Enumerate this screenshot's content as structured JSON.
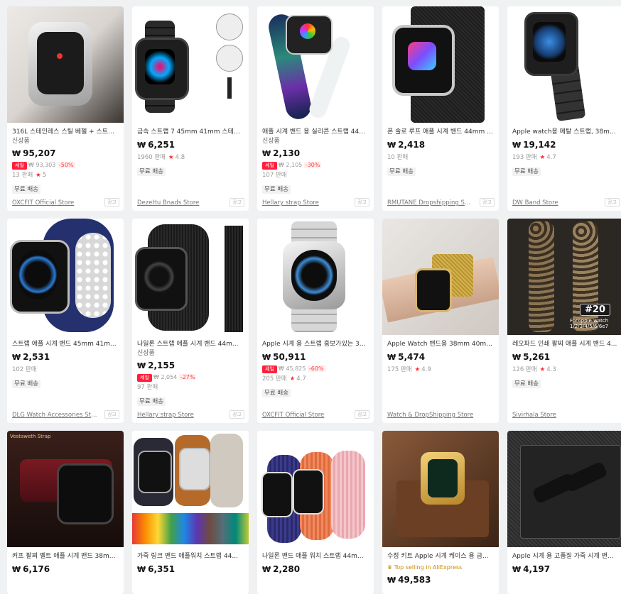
{
  "products": [
    {
      "title": "316L 스테인레스 스틸 베젤 + 스트랩...",
      "tag": "신상품",
      "price": "95,207",
      "sale_badge": "세일",
      "original": "93,303",
      "discount": "-50%",
      "sold": "13 판매",
      "rating": "5",
      "shipping": "무료 배송",
      "store": "OXCFIT Official Store",
      "ad": "광고"
    },
    {
      "title": "금속 스트랩 7 45mm 41mm 스테인...",
      "price": "6,251",
      "sold": "1960 판매",
      "rating": "4.8",
      "shipping": "무료 배송",
      "store": "DezeHu Bnads Store",
      "ad": "광고"
    },
    {
      "title": "애플 시계 밴드 용 실리콘 스트랩 44...",
      "tag": "신상품",
      "price": "2,130",
      "sale_badge": "세일",
      "original": "2,105",
      "discount": "-30%",
      "sold": "107 판매",
      "shipping": "무료 배송",
      "store": "Hellary strap Store",
      "ad": "광고"
    },
    {
      "title": "폰 솔로 루프 애플 시계 밴드 44mm ...",
      "price": "2,418",
      "sold": "10 판매",
      "shipping": "무료 배송",
      "store": "RMUTANE Dropshipping St...",
      "ad": "광고"
    },
    {
      "title": "Apple watch용 메탈 스트랩, 38mm/...",
      "price": "19,142",
      "sold": "193 판매",
      "rating": "4.7",
      "shipping": "무료 배송",
      "store": "DW Band Store",
      "ad": "광고"
    },
    {
      "title": "스트랩 애플 시계 밴드 45mm 41m...",
      "price": "2,531",
      "sold": "102 판매",
      "shipping": "무료 배송",
      "store": "DLG Watch Accessories Sto...",
      "ad": "광고"
    },
    {
      "title": "나일론 스트랩 애플 시계 밴드 44m...",
      "tag": "신상품",
      "price": "2,155",
      "sale_badge": "세일",
      "original": "2,054",
      "discount": "-27%",
      "sold": "97 판매",
      "shipping": "무료 배송",
      "store": "Hellary strap Store",
      "ad": "광고"
    },
    {
      "title": "Apple 시계 용 스트랩 홈보가있는 30...",
      "price": "50,911",
      "sale_badge": "세일",
      "original": "45,825",
      "discount": "-60%",
      "sold": "205 판매",
      "rating": "4.7",
      "shipping": "무료 배송",
      "store": "OXCFIT Official Store",
      "ad": "광고"
    },
    {
      "title": "Apple Watch 밴드용 38mm 40mm ...",
      "price": "5,474",
      "sold": "175 판매",
      "rating": "4.9",
      "store": "Watch & DropShipping Store"
    },
    {
      "title": "레오파드 인쇄 팔찌 애플 시계 밴드 4...",
      "price": "5,261",
      "sold": "126 판매",
      "rating": "4.3",
      "shipping": "무료 배송",
      "store": "Sivirhala Store",
      "overlay_badge": "#20",
      "overlay_caption": "ForApple watch 1/2/3/4/5/6/6e7"
    },
    {
      "title": "커프 팔찌 벨트 애플 시계 밴드 38m...",
      "price": "6,176",
      "overlay_caption": "Vestaweth Strap"
    },
    {
      "title": "가죽 링크 밴드 애플워치 스트랩 44...",
      "price": "6,351"
    },
    {
      "title": "나일론 밴드 애플 워치 스트랩 44m...",
      "price": "2,280"
    },
    {
      "title": "수정 키트 Apple 시계 케이스 용 금...",
      "top_selling": "Top selling in AliExpress",
      "price": "49,583"
    },
    {
      "title": "Apple 시계 용 고품질 가죽 시계 밴...",
      "price": "4,197"
    }
  ],
  "currency_symbol": "₩",
  "icons": {
    "rating": "star-icon",
    "top_selling": "crown-icon"
  },
  "colors": {
    "sale": "#ff1f3a",
    "star": "#ff2a2a",
    "background": "#f0f1f3"
  }
}
